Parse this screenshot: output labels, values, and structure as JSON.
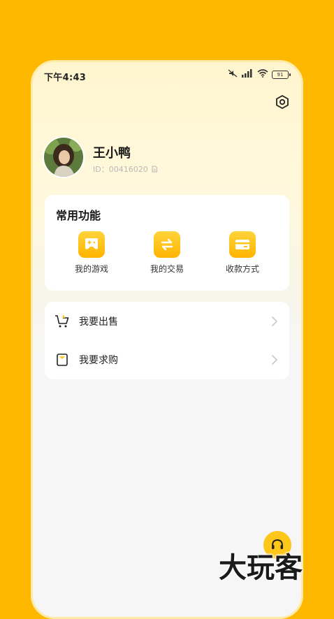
{
  "status_bar": {
    "time": "下午4:43",
    "battery": "91",
    "icons": [
      "mute-icon",
      "signal-icon",
      "wifi-icon",
      "battery-icon"
    ]
  },
  "profile": {
    "name": "王小鸭",
    "id_text": "ID：00416020"
  },
  "common_functions": {
    "title": "常用功能",
    "items": [
      {
        "label": "我的游戏",
        "icon": "gamepad-icon"
      },
      {
        "label": "我的交易",
        "icon": "exchange-icon"
      },
      {
        "label": "收款方式",
        "icon": "card-icon"
      }
    ]
  },
  "menu": {
    "items": [
      {
        "label": "我要出售",
        "icon": "cart-icon"
      },
      {
        "label": "我要求购",
        "icon": "bag-icon"
      }
    ]
  },
  "watermark": "大玩客",
  "colors": {
    "background": "#FFB800",
    "accent": "#FFC61A"
  }
}
